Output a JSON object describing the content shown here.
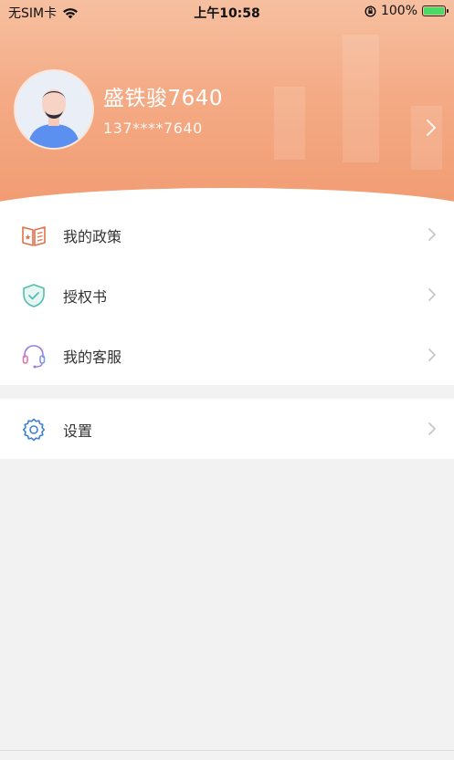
{
  "status_bar": {
    "carrier": "无SIM卡",
    "time": "上午10:58",
    "battery": "100%"
  },
  "profile": {
    "name": "盛铁骏7640",
    "phone": "137****7640"
  },
  "menu_group_1": [
    {
      "label": "我的政策",
      "icon": "policy-book-icon"
    },
    {
      "label": "授权书",
      "icon": "shield-check-icon"
    },
    {
      "label": "我的客服",
      "icon": "headset-icon"
    }
  ],
  "menu_group_2": [
    {
      "label": "设置",
      "icon": "gear-icon"
    }
  ],
  "colors": {
    "header_gradient_top": "#f6c0a0",
    "header_gradient_bottom": "#f19b72",
    "page_background": "#f2f2f2",
    "policy_icon": "#e0714a",
    "auth_icon": "#4fbfb0",
    "service_icon": "#9b7be3",
    "settings_icon": "#3d7fd1"
  }
}
